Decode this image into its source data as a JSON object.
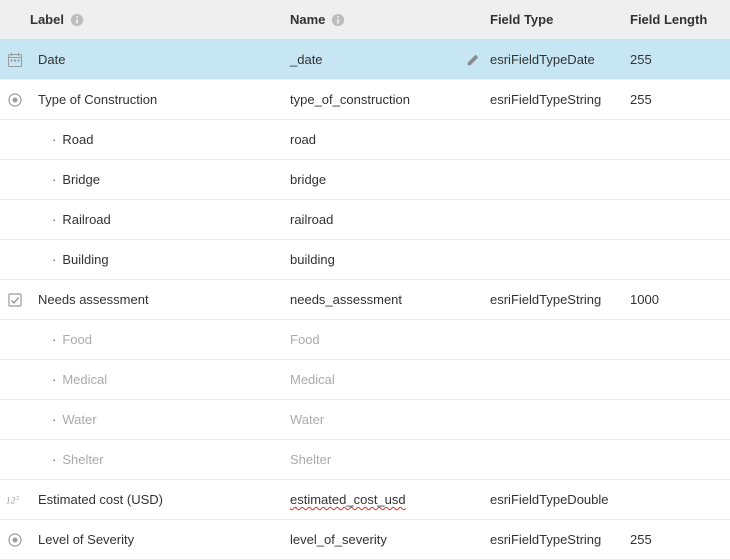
{
  "header": {
    "label": "Label",
    "name": "Name",
    "field_type": "Field Type",
    "field_length": "Field Length"
  },
  "rows": [
    {
      "icon": "calendar",
      "label": "Date",
      "name": "_date",
      "field_type": "esriFieldTypeDate",
      "field_length": "255",
      "selected": true,
      "editable": true
    },
    {
      "icon": "radio",
      "label": "Type of Construction",
      "name": "type_of_construction",
      "field_type": "esriFieldTypeString",
      "field_length": "255",
      "children": [
        {
          "label": "Road",
          "name": "road"
        },
        {
          "label": "Bridge",
          "name": "bridge"
        },
        {
          "label": "Railroad",
          "name": "railroad"
        },
        {
          "label": "Building",
          "name": "building"
        }
      ]
    },
    {
      "icon": "checkbox",
      "label": "Needs assessment",
      "name": "needs_assessment",
      "field_type": "esriFieldTypeString",
      "field_length": "1000",
      "children_muted": true,
      "children": [
        {
          "label": "Food",
          "name": "Food"
        },
        {
          "label": "Medical",
          "name": "Medical"
        },
        {
          "label": "Water",
          "name": "Water"
        },
        {
          "label": "Shelter",
          "name": "Shelter"
        }
      ]
    },
    {
      "icon": "number",
      "label": "Estimated cost (USD)",
      "name": "estimated_cost_usd",
      "name_squiggle": true,
      "field_type": "esriFieldTypeDouble",
      "field_length": ""
    },
    {
      "icon": "radio",
      "label": "Level of Severity",
      "name": "level_of_severity",
      "field_type": "esriFieldTypeString",
      "field_length": "255"
    }
  ]
}
